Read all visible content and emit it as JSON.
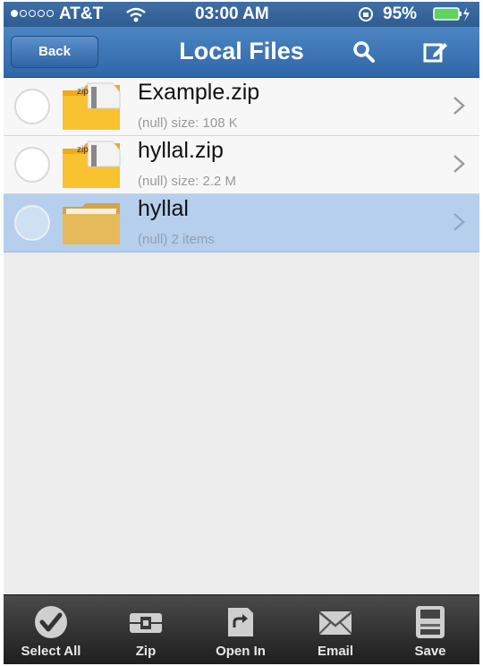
{
  "status_bar": {
    "carrier": "AT&T",
    "time": "03:00 AM",
    "battery": "95%",
    "signal_dots_filled": 1,
    "signal_dots_total": 5
  },
  "nav": {
    "back_label": "Back",
    "title": "Local Files",
    "search_icon": "search-icon",
    "edit_icon": "compose-icon"
  },
  "files": [
    {
      "name": "Example.zip",
      "meta": "(null)  size: 108 K",
      "type": "zip",
      "selected": false
    },
    {
      "name": "hyllal.zip",
      "meta": "(null)  size: 2.2 M",
      "type": "zip",
      "selected": false
    },
    {
      "name": "hyllal",
      "meta": "(null)  2 items",
      "type": "folder",
      "selected": true
    }
  ],
  "zip_icon_text": "zip",
  "toolbar": [
    {
      "label": "Select All",
      "icon": "checkmark-icon"
    },
    {
      "label": "Zip",
      "icon": "zip-icon"
    },
    {
      "label": "Open In",
      "icon": "open-in-icon"
    },
    {
      "label": "Email",
      "icon": "envelope-icon"
    },
    {
      "label": "Save",
      "icon": "save-icon"
    }
  ],
  "colors": {
    "nav_blue": "#3a74b6",
    "selected_row": "#b6cfec",
    "toolbar_dark": "#2e2e2e"
  }
}
